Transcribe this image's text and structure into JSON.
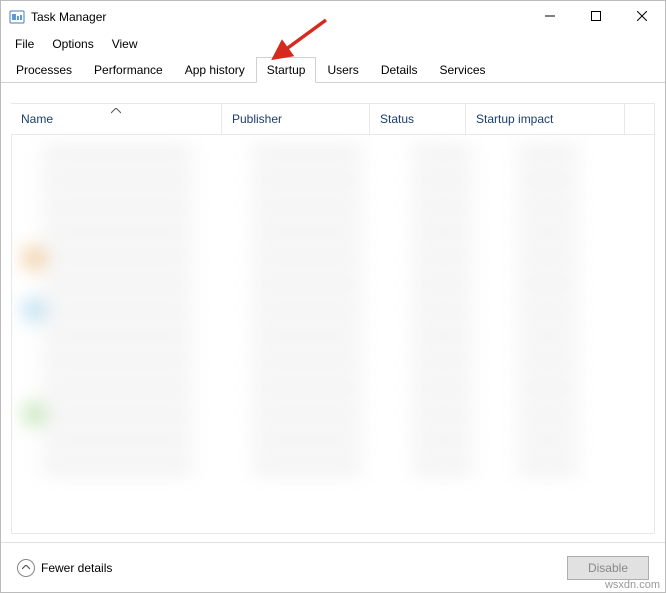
{
  "titlebar": {
    "title": "Task Manager"
  },
  "menubar": {
    "items": [
      "File",
      "Options",
      "View"
    ]
  },
  "tabs": [
    {
      "label": "Processes",
      "active": false
    },
    {
      "label": "Performance",
      "active": false
    },
    {
      "label": "App history",
      "active": false
    },
    {
      "label": "Startup",
      "active": true
    },
    {
      "label": "Users",
      "active": false
    },
    {
      "label": "Details",
      "active": false
    },
    {
      "label": "Services",
      "active": false
    }
  ],
  "columns": {
    "name": "Name",
    "publisher": "Publisher",
    "status": "Status",
    "impact": "Startup impact"
  },
  "sorted_column": "name",
  "sort_direction": "asc",
  "footer": {
    "fewer_label": "Fewer details",
    "disable_label": "Disable",
    "disable_enabled": false
  },
  "annotation": {
    "arrow_target": "startup-tab",
    "color": "#d62a1e"
  },
  "watermark": "wsxdn.com"
}
